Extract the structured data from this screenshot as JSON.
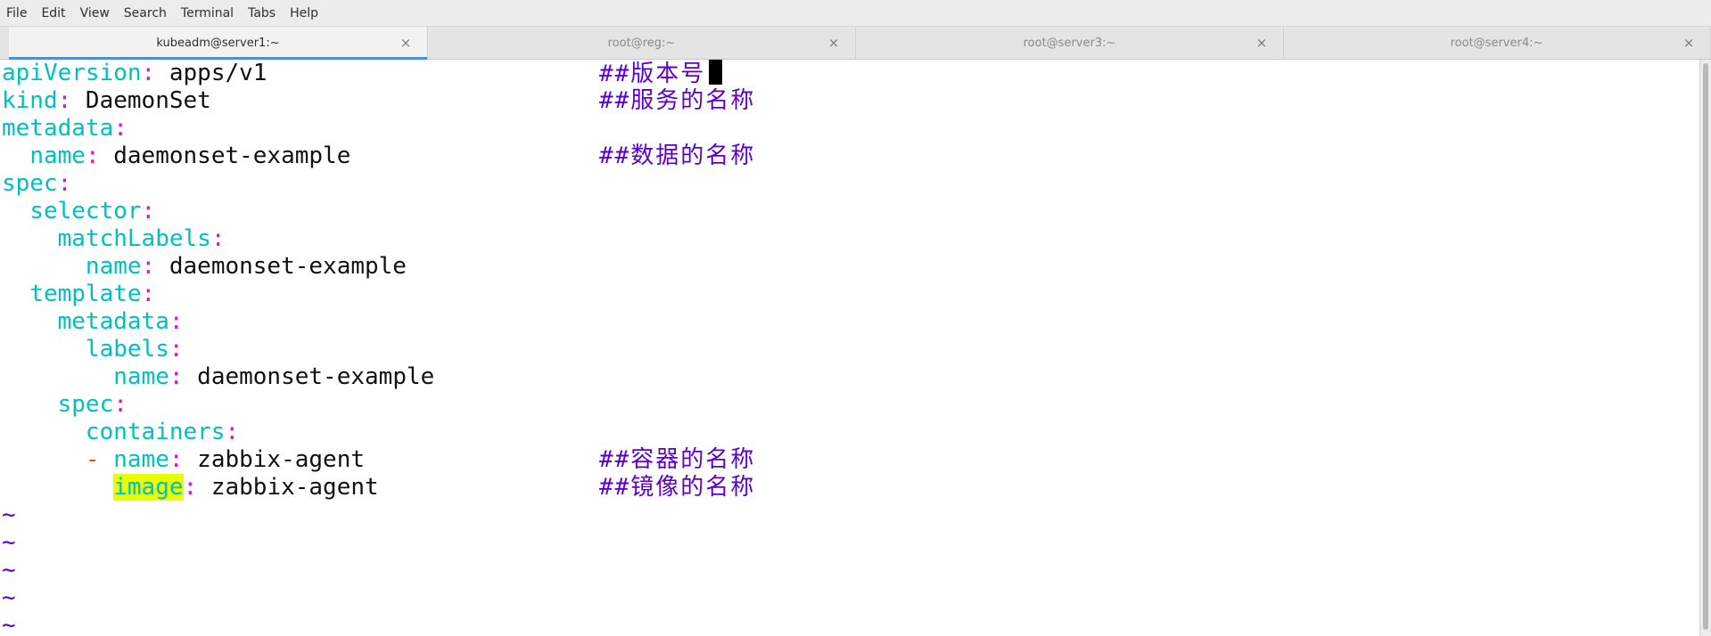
{
  "menu": [
    "File",
    "Edit",
    "View",
    "Search",
    "Terminal",
    "Tabs",
    "Help"
  ],
  "tabs": [
    {
      "title": "kubeadm@server1:~",
      "active": true,
      "close": "×"
    },
    {
      "title": "root@reg:~",
      "active": false,
      "close": "×"
    },
    {
      "title": "root@server3:~",
      "active": false,
      "close": "×"
    },
    {
      "title": "root@server4:~",
      "active": false,
      "close": "×"
    }
  ],
  "editor": {
    "lines": [
      {
        "indent": "",
        "dash": "",
        "key": "apiVersion",
        "value": " apps/v1",
        "comment": "##版本号"
      },
      {
        "indent": "",
        "dash": "",
        "key": "kind",
        "value": " DaemonSet",
        "comment": "##服务的名称"
      },
      {
        "indent": "",
        "dash": "",
        "key": "metadata",
        "value": "",
        "comment": ""
      },
      {
        "indent": "  ",
        "dash": "",
        "key": "name",
        "value": " daemonset-example",
        "comment": "##数据的名称"
      },
      {
        "indent": "",
        "dash": "",
        "key": "spec",
        "value": "",
        "comment": ""
      },
      {
        "indent": "  ",
        "dash": "",
        "key": "selector",
        "value": "",
        "comment": ""
      },
      {
        "indent": "    ",
        "dash": "",
        "key": "matchLabels",
        "value": "",
        "comment": ""
      },
      {
        "indent": "      ",
        "dash": "",
        "key": "name",
        "value": " daemonset-example",
        "comment": ""
      },
      {
        "indent": "  ",
        "dash": "",
        "key": "template",
        "value": "",
        "comment": ""
      },
      {
        "indent": "    ",
        "dash": "",
        "key": "metadata",
        "value": "",
        "comment": ""
      },
      {
        "indent": "      ",
        "dash": "",
        "key": "labels",
        "value": "",
        "comment": ""
      },
      {
        "indent": "        ",
        "dash": "",
        "key": "name",
        "value": " daemonset-example",
        "comment": ""
      },
      {
        "indent": "    ",
        "dash": "",
        "key": "spec",
        "value": "",
        "comment": ""
      },
      {
        "indent": "      ",
        "dash": "",
        "key": "containers",
        "value": "",
        "comment": ""
      },
      {
        "indent": "      ",
        "dash": "-",
        "key": "name",
        "value": " zabbix-agent",
        "comment": "##容器的名称"
      },
      {
        "indent": "        ",
        "dash": "",
        "key": "image",
        "value": " zabbix-agent",
        "comment": "##镜像的名称",
        "highlight": true
      }
    ],
    "empty_line_marker": "~",
    "empty_lines": 5,
    "cursor_line": 0,
    "colors": {
      "key": "#00c0c0",
      "colon": "#e010d8",
      "comment": "#5a00d0",
      "search_highlight": "#e8ff00"
    }
  }
}
